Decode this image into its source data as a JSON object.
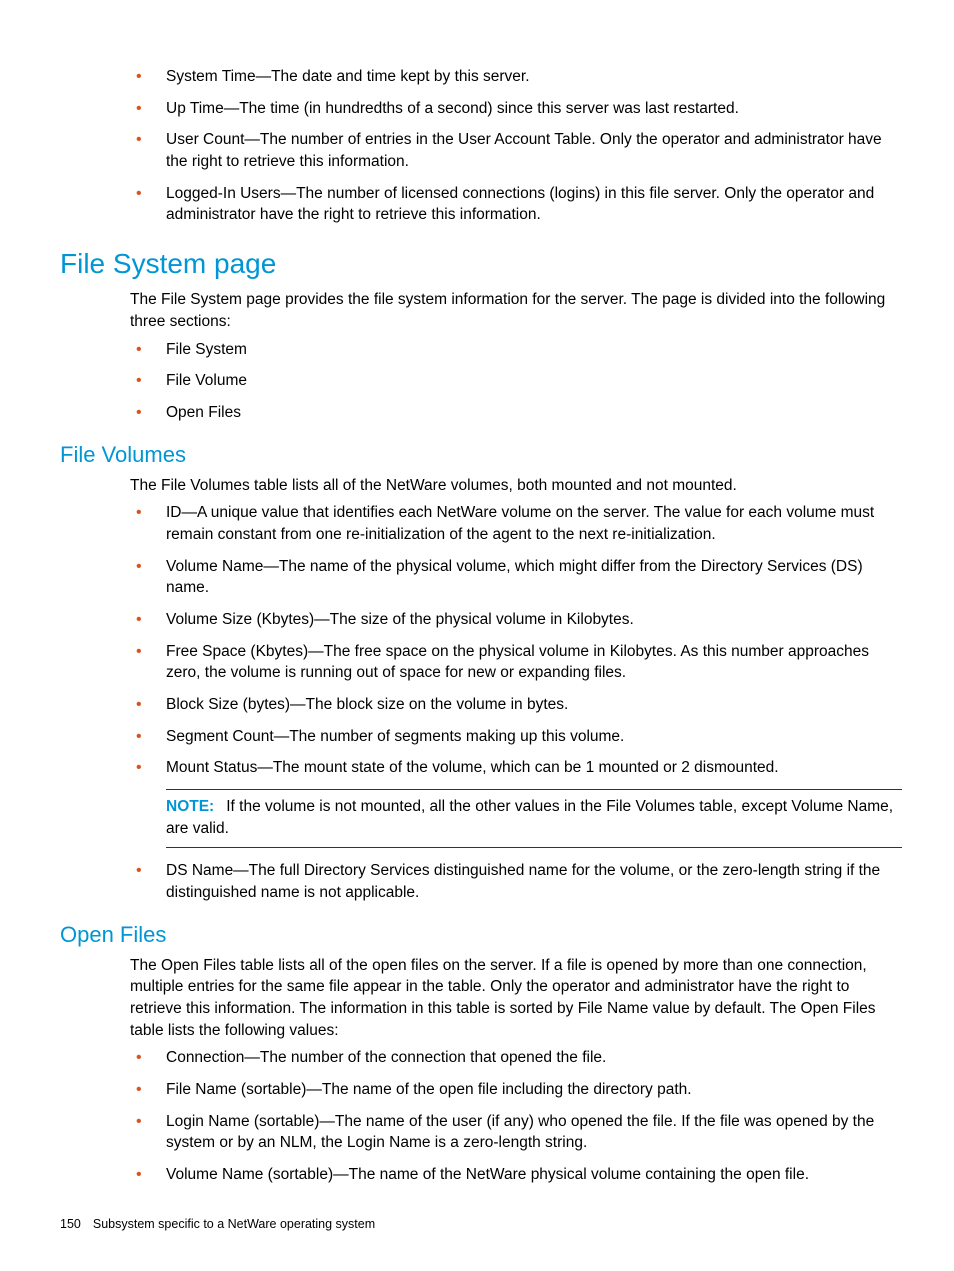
{
  "top_list": [
    "System Time—The date and time kept by this server.",
    "Up Time—The time (in hundredths of a second) since this server was last restarted.",
    "User Count—The number of entries in the User Account Table. Only the operator and administrator have the right to retrieve this information.",
    "Logged-In Users—The number of licensed connections (logins) in this file server. Only the operator and administrator have the right to retrieve this information."
  ],
  "fs_heading": "File System page",
  "fs_intro": "The File System page provides the file system information for the server. The page is divided into the following three sections:",
  "fs_list": [
    "File System",
    "File Volume",
    "Open Files"
  ],
  "vol_heading": "File Volumes",
  "vol_intro": "The File Volumes table lists all of the NetWare volumes, both mounted and not mounted.",
  "vol_list_a": [
    "ID—A unique value that identifies each NetWare volume on the server. The value for each volume must remain constant from one re-initialization of the agent to the next re-initialization.",
    "Volume Name—The name of the physical volume, which might differ from the Directory Services (DS) name.",
    "Volume Size (Kbytes)—The size of the physical volume in Kilobytes.",
    "Free Space (Kbytes)—The free space on the physical volume in Kilobytes. As this number approaches zero, the volume is running out of space for new or expanding files.",
    "Block Size (bytes)—The block size on the volume in bytes.",
    "Segment Count—The number of segments making up this volume.",
    "Mount Status—The mount state of the volume, which can be 1 mounted or 2 dismounted."
  ],
  "note_label": "NOTE:",
  "note_text": "If the volume is not mounted, all the other values in the File Volumes table, except Volume Name, are valid.",
  "vol_list_b": [
    "DS Name—The full Directory Services distinguished name for the volume, or the zero-length string if the distinguished name is not applicable."
  ],
  "open_heading": "Open Files",
  "open_intro": "The Open Files table lists all of the open files on the server. If a file is opened by more than one connection, multiple entries for the same file appear in the table. Only the operator and administrator have the right to retrieve this information. The information in this table is sorted by File Name value by default. The Open Files table lists the following values:",
  "open_list": [
    "Connection—The number of the connection that opened the file.",
    "File Name (sortable)—The name of the open file including the directory path.",
    "Login Name (sortable)—The name of the user (if any) who opened the file. If the file was opened by the system or by an NLM, the Login Name is a zero-length string.",
    "Volume Name (sortable)—The name of the NetWare physical volume containing the open file."
  ],
  "page_number": "150",
  "footer_text": "Subsystem specific to a NetWare operating system"
}
